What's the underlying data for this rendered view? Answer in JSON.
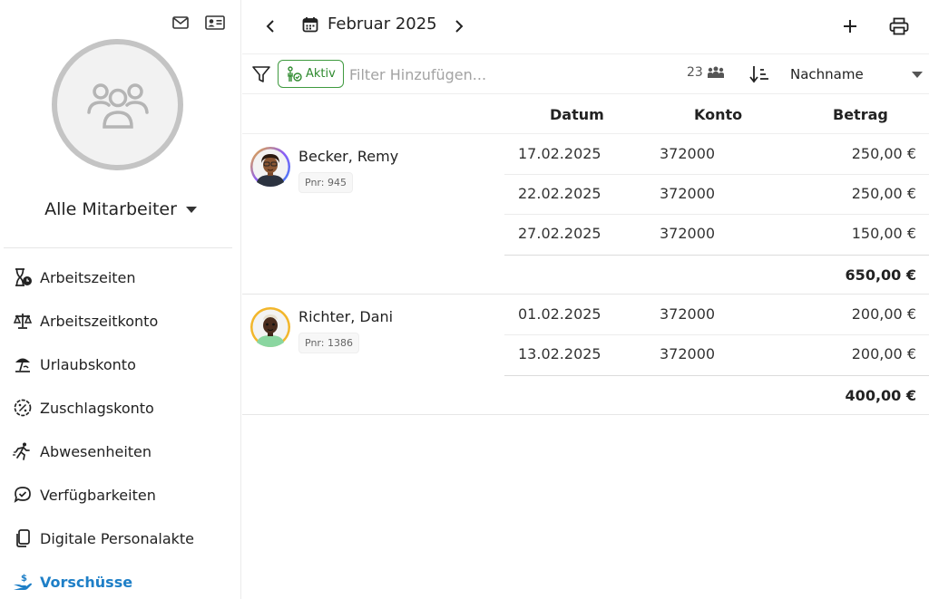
{
  "sidebar": {
    "group_label": "Alle Mitarbeiter",
    "nav": [
      {
        "label": "Arbeitszeiten",
        "icon": "hourglass-clock-icon"
      },
      {
        "label": "Arbeitszeitkonto",
        "icon": "scale-icon"
      },
      {
        "label": "Urlaubskonto",
        "icon": "beach-umbrella-icon"
      },
      {
        "label": "Zuschlagskonto",
        "icon": "percent-badge-icon"
      },
      {
        "label": "Abwesenheiten",
        "icon": "running-person-icon"
      },
      {
        "label": "Verfügbarkeiten",
        "icon": "chat-check-icon"
      },
      {
        "label": "Digitale Personalakte",
        "icon": "documents-icon"
      },
      {
        "label": "Vorschüsse",
        "icon": "hand-money-icon",
        "active": true
      }
    ]
  },
  "topbar": {
    "month": "Februar 2025"
  },
  "filterbar": {
    "chip_label": "Aktiv",
    "placeholder": "Filter Hinzufügen...",
    "count": "23",
    "sort_label": "Nachname"
  },
  "table": {
    "headers": {
      "datum": "Datum",
      "konto": "Konto",
      "betrag": "Betrag"
    },
    "groups": [
      {
        "name": "Becker, Remy",
        "pnr": "Pnr: 945",
        "rows": [
          {
            "datum": "17.02.2025",
            "konto": "372000",
            "betrag": "250,00 €"
          },
          {
            "datum": "22.02.2025",
            "konto": "372000",
            "betrag": "250,00 €"
          },
          {
            "datum": "27.02.2025",
            "konto": "372000",
            "betrag": "150,00 €"
          }
        ],
        "total": "650,00 €"
      },
      {
        "name": "Richter, Dani",
        "pnr": "Pnr: 1386",
        "rows": [
          {
            "datum": "01.02.2025",
            "konto": "372000",
            "betrag": "200,00 €"
          },
          {
            "datum": "13.02.2025",
            "konto": "372000",
            "betrag": "200,00 €"
          }
        ],
        "total": "400,00 €"
      }
    ]
  },
  "colors": {
    "accent": "#1e7fc7",
    "chip_green": "#2f8a2f"
  }
}
